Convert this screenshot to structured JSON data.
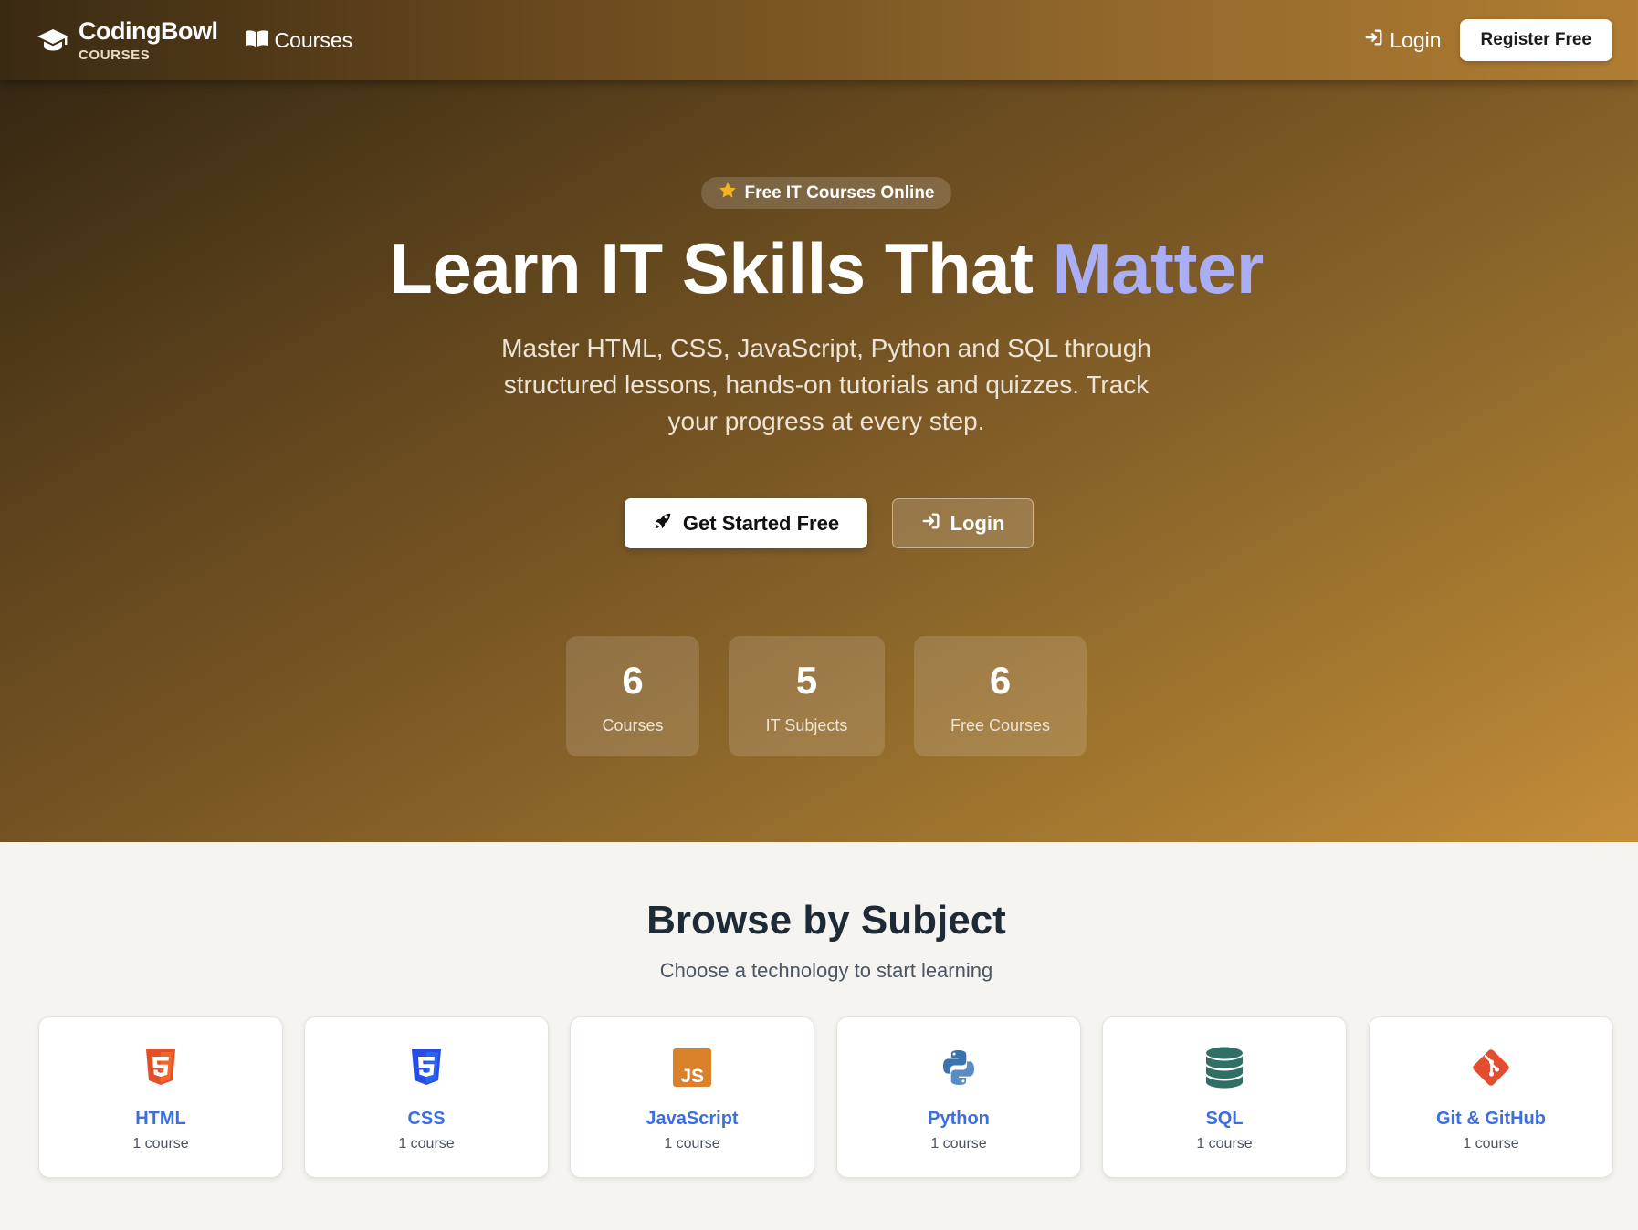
{
  "nav": {
    "brand_name": "CodingBowl",
    "brand_sub": "COURSES",
    "courses_label": "Courses",
    "login_label": "Login",
    "register_label": "Register Free"
  },
  "hero": {
    "badge": "Free IT Courses Online",
    "title_main": "Learn IT Skills That ",
    "title_accent": "Matter",
    "subtitle": "Master HTML, CSS, JavaScript, Python and SQL through structured lessons, hands-on tutorials and quizzes. Track your progress at every step.",
    "primary_button": "Get Started Free",
    "secondary_button": "Login",
    "stats": [
      {
        "value": "6",
        "label": "Courses"
      },
      {
        "value": "5",
        "label": "IT Subjects"
      },
      {
        "value": "6",
        "label": "Free Courses"
      }
    ]
  },
  "subjects": {
    "title": "Browse by Subject",
    "subtitle": "Choose a technology to start learning",
    "cards": [
      {
        "name": "HTML",
        "count": "1 course",
        "icon": "html5-icon",
        "color": "#e34f26"
      },
      {
        "name": "CSS",
        "count": "1 course",
        "icon": "css3-icon",
        "color": "#264de4"
      },
      {
        "name": "JavaScript",
        "count": "1 course",
        "icon": "js-icon",
        "color": "#d9822b"
      },
      {
        "name": "Python",
        "count": "1 course",
        "icon": "python-icon",
        "color": "#3776ab"
      },
      {
        "name": "SQL",
        "count": "1 course",
        "icon": "database-icon",
        "color": "#2f6f64"
      },
      {
        "name": "Git & GitHub",
        "count": "1 course",
        "icon": "git-icon",
        "color": "#e44c30"
      }
    ]
  },
  "colors": {
    "accent": "#a9aef5",
    "link_blue": "#3b6ee0",
    "star": "#f4b41a"
  }
}
